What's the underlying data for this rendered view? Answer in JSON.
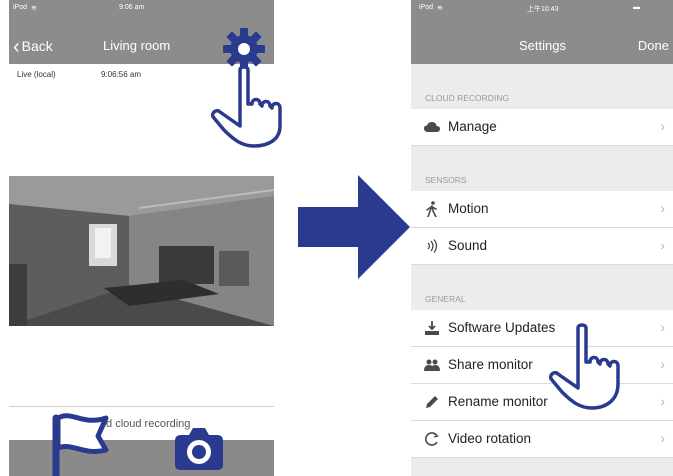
{
  "left_screen": {
    "status": {
      "device": "iPod",
      "time": "9:06 am"
    },
    "nav": {
      "back_label": "Back",
      "title": "Living room"
    },
    "live_row": {
      "label": "Live (local)",
      "time": "9:06:56 am"
    },
    "add_cloud_recording": "Add cloud recording"
  },
  "right_screen": {
    "status": {
      "device": "iPod",
      "time": "上午10:43"
    },
    "nav": {
      "title": "Settings",
      "done_label": "Done"
    },
    "sections": [
      {
        "header": "CLOUD RECORDING",
        "rows": [
          {
            "label": "Manage",
            "icon": "cloud-icon"
          }
        ]
      },
      {
        "header": "SENSORS",
        "rows": [
          {
            "label": "Motion",
            "icon": "walking-person-icon"
          },
          {
            "label": "Sound",
            "icon": "sound-waves-icon"
          }
        ]
      },
      {
        "header": "GENERAL",
        "rows": [
          {
            "label": "Software Updates",
            "icon": "download-icon"
          },
          {
            "label": "Share monitor",
            "icon": "users-icon"
          },
          {
            "label": "Rename monitor",
            "icon": "pencil-icon"
          },
          {
            "label": "Video rotation",
            "icon": "rotate-icon"
          }
        ]
      }
    ],
    "chevron": "›"
  },
  "colors": {
    "nav_bar": "#8c8c8c",
    "arrow": "#2a3a8f",
    "highlight": "#2a3a8f"
  }
}
